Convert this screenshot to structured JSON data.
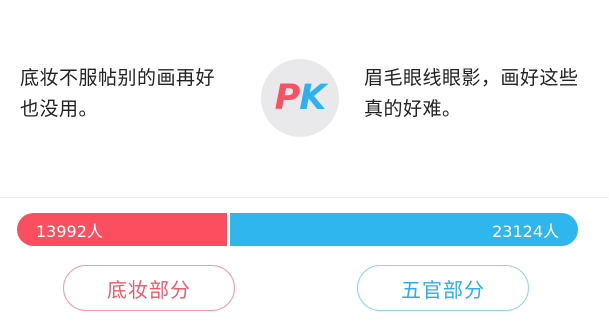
{
  "left_option": {
    "text_line1": "底妆不服帖别的画再好",
    "text_line2": "也没用。",
    "vote_count": "13992人",
    "button_label": "底妆部分",
    "color": "#fb4e5f"
  },
  "right_option": {
    "text_line1": "眉毛眼线眼影，画好这些",
    "text_line2": "真的好难。",
    "vote_count": "23124人",
    "button_label": "五官部分",
    "color": "#2fb6ee"
  },
  "pk_badge": {
    "letter_p": "P",
    "letter_k": "K"
  },
  "vote_share": {
    "left_fraction": 0.377,
    "right_fraction": 0.623
  }
}
